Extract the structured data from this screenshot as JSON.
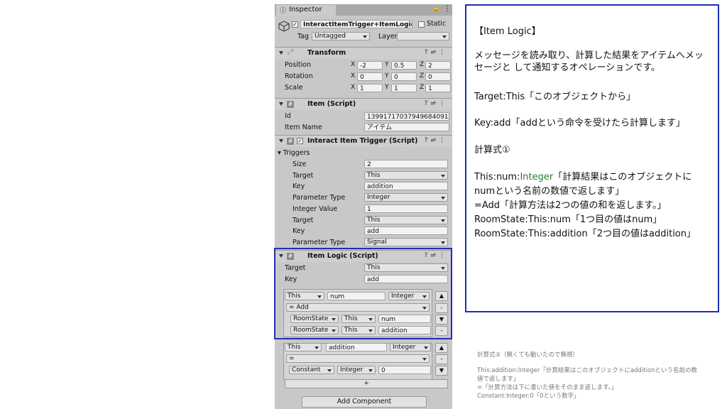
{
  "inspector": {
    "tab_label": "Inspector",
    "object_name": "InteractItemTrigger+ItemLogic",
    "static_label": "Static",
    "tag_label": "Tag",
    "tag_value": "Untagged",
    "layer_label": "Layer",
    "layer_value": "",
    "add_component": "Add Component"
  },
  "transform": {
    "title": "Transform",
    "rows": [
      {
        "label": "Position",
        "x": "-2",
        "y": "0.5",
        "z": "2"
      },
      {
        "label": "Rotation",
        "x": "0",
        "y": "0",
        "z": "0"
      },
      {
        "label": "Scale",
        "x": "1",
        "y": "1",
        "z": "1"
      }
    ],
    "axis": {
      "x": "X",
      "y": "Y",
      "z": "Z"
    }
  },
  "item_script": {
    "title": "Item (Script)",
    "id_label": "Id",
    "id_value": "1399171703794968409​1",
    "name_label": "Item Name",
    "name_value": "アイテム"
  },
  "trigger_script": {
    "title": "Interact Item Trigger (Script)",
    "triggers_label": "Triggers",
    "rows": [
      {
        "label": "Size",
        "value": "2",
        "type": "field"
      },
      {
        "label": "Target",
        "value": "This",
        "type": "dropdown"
      },
      {
        "label": "Key",
        "value": "addition",
        "type": "field"
      },
      {
        "label": "Parameter Type",
        "value": "Integer",
        "type": "dropdown"
      },
      {
        "label": "Integer Value",
        "value": "1",
        "type": "field"
      },
      {
        "label": "Target",
        "value": "This",
        "type": "dropdown"
      },
      {
        "label": "Key",
        "value": "add",
        "type": "field"
      },
      {
        "label": "Parameter Type",
        "value": "Signal",
        "type": "dropdown"
      }
    ]
  },
  "logic_script": {
    "title": "Item Logic (Script)",
    "target_label": "Target",
    "target_value": "This",
    "key_label": "Key",
    "key_value": "add",
    "block1": {
      "row1": {
        "target": "This",
        "name": "num",
        "type": "Integer"
      },
      "op": "= Add",
      "row3": {
        "a": "RoomState",
        "b": "This",
        "c": "num"
      },
      "row4": {
        "a": "RoomState",
        "b": "This",
        "c": "addition"
      }
    },
    "block2": {
      "row1": {
        "target": "This",
        "name": "addition",
        "type": "Integer"
      },
      "op": "=",
      "row3": {
        "a": "Constant",
        "b": "Integer",
        "c": "0"
      }
    },
    "plus": "+",
    "minus": "-",
    "up": "▲",
    "down": "▼"
  },
  "note": {
    "heading": "【Item Logic】",
    "sub": "メッセージを読み取り、計算した結果をアイテムへメッセージと して通知するオペレーションです。",
    "line1": "Target:This「このオブジェクトから」",
    "line2": "Key:add「addという命令を受けたら計算します」",
    "line3": "計算式①",
    "line4_pre": "This:num:",
    "line4_green": "Integer",
    "line4_post": "「計算結果はこのオブジェクトに",
    "line5": "numという名前の数値で返します」",
    "line6": "=Add「計算方法は2つの値の和を返します。」",
    "line7": "RoomState:This:num「1つ目の値はnum」",
    "line8": "RoomState:This:addition「2つ目の値はaddition」"
  },
  "gray_note": {
    "l1": "計算式②（無くても動いたので無視）",
    "l2": "This:addition:Integer「計算結果はこのオブジェクトにadditionという名前の数",
    "l3": "値で返します」",
    "l4": "=「計算方法は下に書いた値をそのまま返します。」",
    "l5": "Constant:Integer:0「0という数字」"
  },
  "colors": {
    "highlight_border": "#1f2fb2",
    "note_green": "#2e7d32"
  }
}
